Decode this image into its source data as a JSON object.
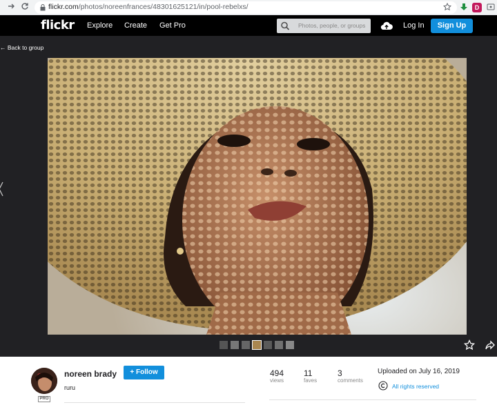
{
  "browser": {
    "url_host": "flickr.com",
    "url_path": "/photos/noreenfrances/48301625121/in/pool-rebelxs/"
  },
  "header": {
    "logo": "flickr",
    "nav": [
      "Explore",
      "Create",
      "Get Pro"
    ],
    "search_placeholder": "Photos, people, or groups",
    "login": "Log In",
    "signup": "Sign Up"
  },
  "stage": {
    "back_label": "Back to group"
  },
  "photo_info": {
    "owner_name": "noreen brady",
    "pro_badge": "PRO",
    "follow_label": "+ Follow",
    "caption": "ruru",
    "stats": [
      {
        "value": "494",
        "label": "views"
      },
      {
        "value": "11",
        "label": "faves"
      },
      {
        "value": "3",
        "label": "comments"
      }
    ],
    "uploaded": "Uploaded on July 16, 2019",
    "rights": "All rights reserved"
  },
  "colors": {
    "brand_blue": "#128fdc",
    "header_black": "#000000",
    "stage_bg": "#212124"
  }
}
